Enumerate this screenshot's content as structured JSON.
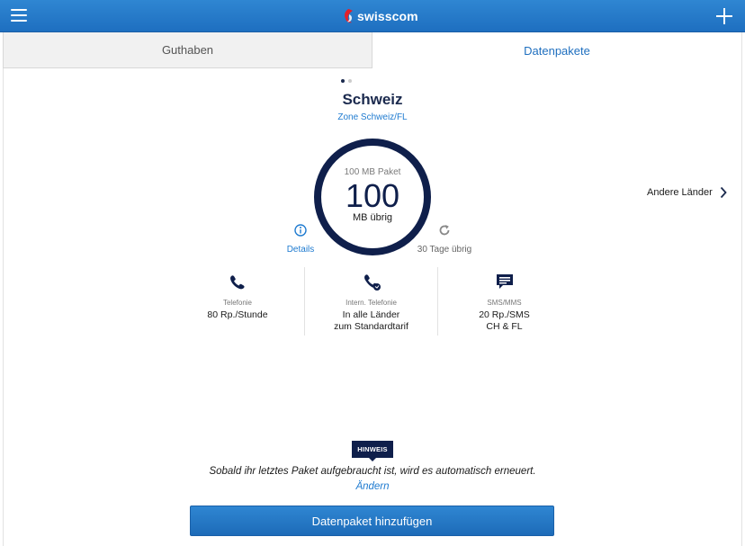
{
  "header": {
    "brand": "swisscom",
    "menu_icon": "hamburger-menu-icon",
    "add_icon": "plus-icon",
    "brand_color": "#1e6fc0"
  },
  "tabs": [
    {
      "label": "Guthaben",
      "active": false
    },
    {
      "label": "Datenpakete",
      "active": true
    }
  ],
  "pager": {
    "count": 2,
    "active_index": 0
  },
  "package": {
    "country": "Schweiz",
    "zone": "Zone Schweiz/FL",
    "package_label": "100 MB Paket",
    "remaining_value": "100",
    "remaining_unit": "MB übrig",
    "remaining_fraction": 1.0,
    "details_label": "Details",
    "days_label": "30 Tage übrig",
    "ring_color": "#0f1f4b"
  },
  "other_countries": {
    "label": "Andere Länder"
  },
  "features": [
    {
      "icon": "phone-icon",
      "label": "Telefonie",
      "value_lines": [
        "80 Rp./Stunde"
      ]
    },
    {
      "icon": "international-phone-icon",
      "label": "Intern. Telefonie",
      "value_lines": [
        "In alle Länder",
        "zum Standardtarif"
      ]
    },
    {
      "icon": "sms-icon",
      "label": "SMS/MMS",
      "value_lines": [
        "20 Rp./SMS",
        "CH & FL"
      ]
    }
  ],
  "notice": {
    "badge": "HINWEIS",
    "text": "Sobald ihr letztes Paket aufgebraucht ist, wird es automatisch erneuert.",
    "link": "Ändern"
  },
  "actions": {
    "add_package": "Datenpaket hinzufügen"
  }
}
